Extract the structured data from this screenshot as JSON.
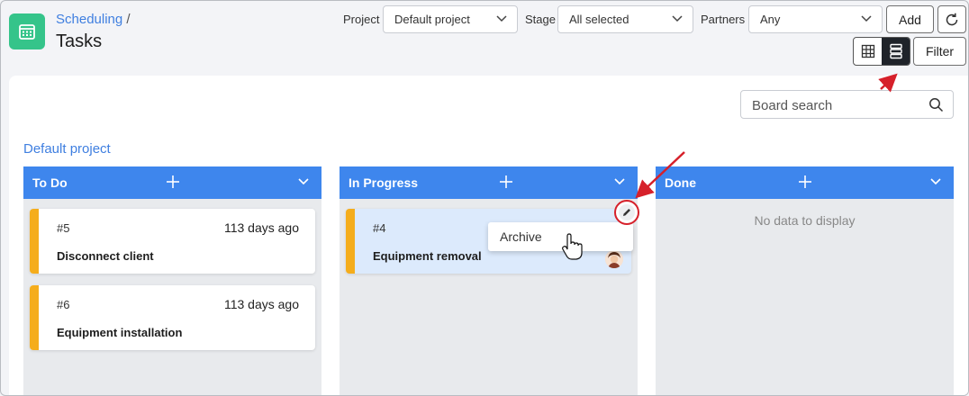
{
  "breadcrumb": {
    "parent": "Scheduling",
    "separator": "/"
  },
  "page_title": "Tasks",
  "filters": {
    "project_label": "Project",
    "project_value": "Default project",
    "stage_label": "Stage",
    "stage_value": "All selected",
    "partners_label": "Partners",
    "partners_value": "Any"
  },
  "toolbar": {
    "add_label": "Add",
    "filter_label": "Filter"
  },
  "search": {
    "placeholder": "Board search"
  },
  "project_title": "Default project",
  "columns": [
    {
      "title": "To Do",
      "cards": [
        {
          "number": "#5",
          "time": "113 days ago",
          "title": "Disconnect client"
        },
        {
          "number": "#6",
          "time": "113 days ago",
          "title": "Equipment installation"
        }
      ]
    },
    {
      "title": "In Progress",
      "cards": [
        {
          "number": "#4",
          "title": "Equipment removal"
        }
      ]
    },
    {
      "title": "Done",
      "empty_text": "No data to display"
    }
  ],
  "context_menu": {
    "archive_label": "Archive"
  },
  "colors": {
    "accent": "#3e86ed",
    "app_icon": "#35c48a",
    "card_stripe": "#f5ad1c",
    "annotation": "#d6202a"
  },
  "icons": [
    "calendar-icon",
    "chevron-down-icon",
    "refresh-icon",
    "grid-view-icon",
    "list-view-icon",
    "search-icon",
    "plus-icon",
    "edit-icon",
    "avatar",
    "hand-cursor-icon"
  ]
}
